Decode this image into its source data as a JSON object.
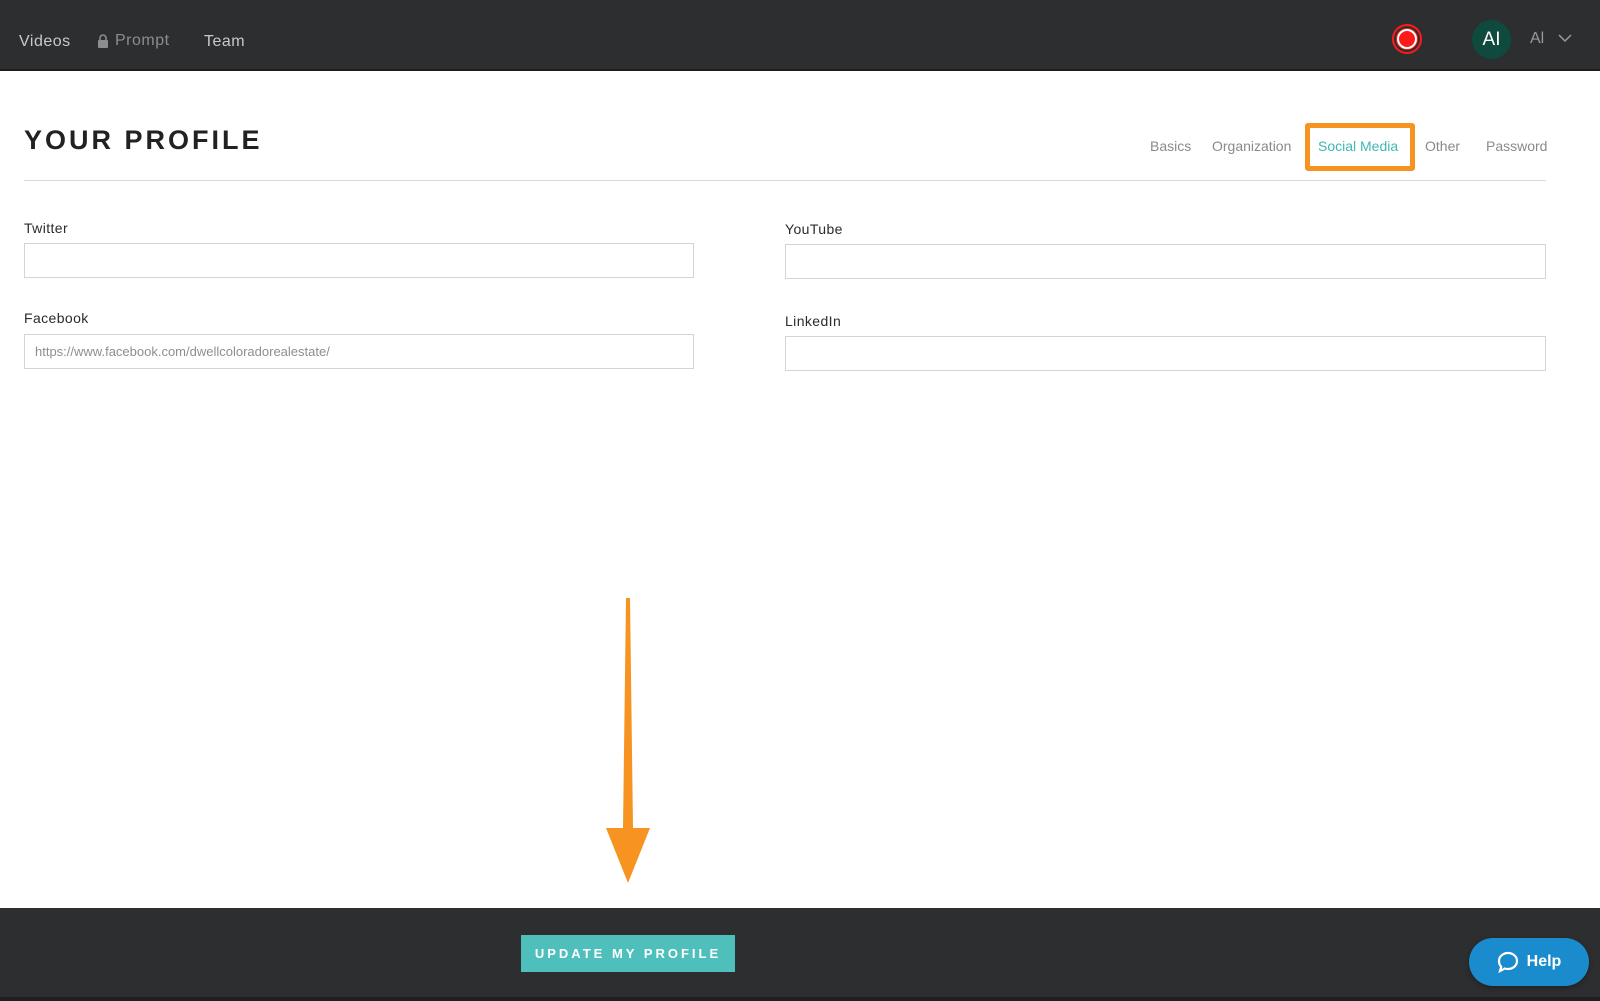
{
  "nav": {
    "videos": "Videos",
    "prompt": "Prompt",
    "team": "Team"
  },
  "user": {
    "initials": "AI",
    "name": "Al"
  },
  "profile": {
    "title": "YOUR PROFILE",
    "tabs": [
      {
        "label": "Basics"
      },
      {
        "label": "Organization"
      },
      {
        "label": "Social Media",
        "active": true
      },
      {
        "label": "Other"
      },
      {
        "label": "Password"
      }
    ]
  },
  "form": {
    "twitter": {
      "label": "Twitter",
      "value": ""
    },
    "facebook": {
      "label": "Facebook",
      "value": "https://www.facebook.com/dwellcoloradorealestate/"
    },
    "youtube": {
      "label": "YouTube",
      "value": ""
    },
    "linkedin": {
      "label": "LinkedIn",
      "value": ""
    }
  },
  "footer": {
    "update_label": "UPDATE MY PROFILE",
    "help_label": "Help"
  },
  "colors": {
    "accent": "#4fbfbc",
    "highlight": "#f79320",
    "help": "#1a8ccd",
    "record": "#ff1a1a",
    "avatar": "#0e4a3d"
  },
  "icons": {
    "lock": "lock-icon",
    "record": "record-icon",
    "chevron": "chevron-down-icon",
    "arrow": "arrow-down-icon",
    "chat": "chat-bubble-icon"
  }
}
